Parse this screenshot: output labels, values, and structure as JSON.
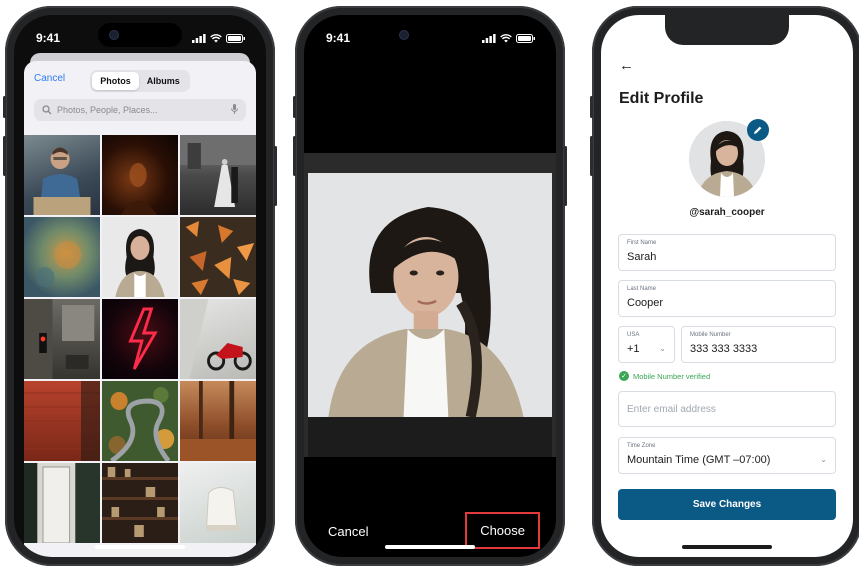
{
  "status": {
    "time": "9:41"
  },
  "photo_picker": {
    "cancel_label": "Cancel",
    "tabs": [
      "Photos",
      "Albums"
    ],
    "active_tab": "Photos",
    "search_placeholder": "Photos, People, Places..."
  },
  "cropper": {
    "cancel_label": "Cancel",
    "choose_label": "Choose"
  },
  "edit_profile": {
    "title": "Edit Profile",
    "username": "@sarah_cooper",
    "first_name": {
      "label": "First Name",
      "value": "Sarah"
    },
    "last_name": {
      "label": "Last Name",
      "value": "Cooper"
    },
    "country": {
      "label": "USA",
      "value": "+1"
    },
    "mobile": {
      "label": "Mobile Number",
      "value": "333 333 3333"
    },
    "verified_text": "Mobile Number verified",
    "email": {
      "placeholder": "Enter email address"
    },
    "time_zone": {
      "label": "Time Zone",
      "value": "Mountain Time (GMT –07:00)"
    },
    "save_label": "Save Changes"
  },
  "colors": {
    "accent_blue": "#0b5a86",
    "ios_link": "#2f7cf6",
    "verified_green": "#3aa655",
    "highlight_red": "#e23a3a"
  }
}
